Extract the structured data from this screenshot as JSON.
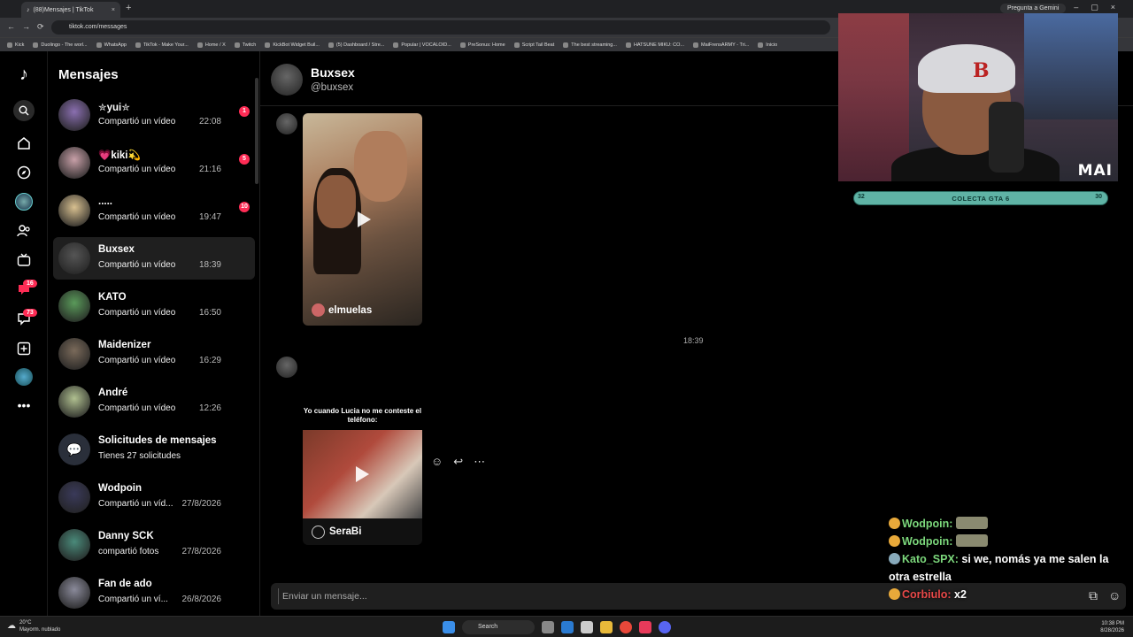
{
  "browser": {
    "tab_title": "(88)Mensajes | TikTok",
    "url": "tiktok.com/messages",
    "gemini_label": "Pregunta a Gemini",
    "bookmarks": [
      "Kick",
      "Duolingo - The worl...",
      "WhatsApp",
      "TikTok - Make Your...",
      "Home / X",
      "Twitch",
      "KickBot Widget Buil...",
      "(5) Dashboard / Stre...",
      "Popular | VOCALOID...",
      "PreSonus: Home",
      "Script Tail Beat",
      "The best streaming...",
      "HATSUNE MIKU: CO...",
      "MaiFrensARMY - Tri...",
      "Inicio"
    ]
  },
  "rail": {
    "icons": [
      "tiktok-logo-icon",
      "search-icon",
      "home-icon",
      "explore-icon",
      "profile-avatar",
      "following-icon",
      "live-icon",
      "activity-icon",
      "messages-icon",
      "upload-icon",
      "avatar-small",
      "more-icon"
    ],
    "activity_badge": "16",
    "messages_badge": "73"
  },
  "inbox": {
    "title": "Mensajes",
    "conversations": [
      {
        "name": "✮yui✮",
        "subtitle": "Compartió un vídeo",
        "time": "22:08",
        "unread": "1",
        "color": "#8a6fb0"
      },
      {
        "name": "💗kiki💫",
        "subtitle": "Compartió un vídeo",
        "time": "21:16",
        "unread": "5",
        "color": "#c8a0a8"
      },
      {
        "name": ".....",
        "subtitle": "Compartió un vídeo",
        "time": "19:47",
        "unread": "10",
        "color": "#d8c090"
      },
      {
        "name": "Buxsex",
        "subtitle": "Compartió un vídeo",
        "time": "18:39",
        "unread": "",
        "color": "#555"
      },
      {
        "name": "KATO",
        "subtitle": "Compartió un vídeo",
        "time": "16:50",
        "unread": "",
        "color": "#5a9a5a"
      },
      {
        "name": "Maidenizer",
        "subtitle": "Compartió un vídeo",
        "time": "16:29",
        "unread": "",
        "color": "#7a6a5a"
      },
      {
        "name": "André",
        "subtitle": "Compartió un vídeo",
        "time": "12:26",
        "unread": "",
        "color": "#b0c090"
      },
      {
        "name": "Solicitudes de mensajes",
        "subtitle": "Tienes 27 solicitudes",
        "time": "",
        "unread": "",
        "color": "#2a2f3a"
      },
      {
        "name": "Wodpoin",
        "subtitle": "Compartió un víd...",
        "time": "27/8/2026",
        "unread": "",
        "color": "#3a3a5a"
      },
      {
        "name": "Danny SCK",
        "subtitle": "compartió fotos",
        "time": "27/8/2026",
        "unread": "",
        "color": "#4a8a7a"
      },
      {
        "name": "Fan de ado",
        "subtitle": "Compartió un ví...",
        "time": "26/8/2026",
        "unread": "",
        "color": "#8a8a9a"
      }
    ]
  },
  "chat": {
    "name": "Buxsex",
    "handle": "@buxsex",
    "video1_creator": "elmuelas",
    "timestamp": "18:39",
    "video2_caption": "Yo cuando Lucia no me conteste el teléfono:",
    "video2_creator": "SeraBi",
    "composer_placeholder": "Enviar un mensaje..."
  },
  "stream": {
    "cam_tag": "MAI",
    "goal_left": "32",
    "goal_label": "COLECTA GTA 6",
    "goal_right": "30",
    "chat": [
      {
        "user": "Wodpoin:",
        "text": ""
      },
      {
        "user": "Wodpoin:",
        "text": ""
      },
      {
        "user": "Kato_SPX:",
        "text": "si we, nomás ya me salen la otra estrella"
      },
      {
        "user": "Corbiulo:",
        "text": "x2"
      }
    ]
  },
  "taskbar": {
    "temp": "20°C",
    "weather": "Mayorm. nublado",
    "search": "Search",
    "time": "10:38 PM",
    "date": "8/28/2026"
  }
}
